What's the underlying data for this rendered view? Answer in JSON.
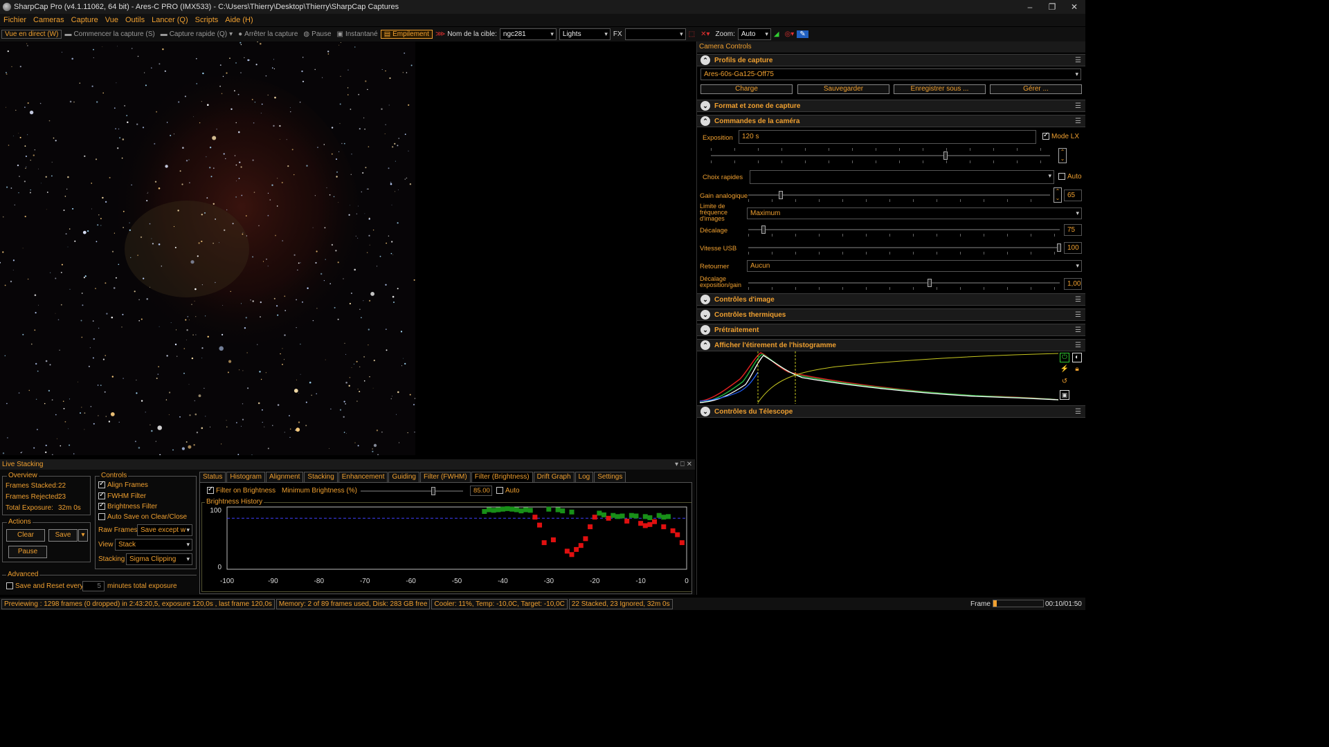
{
  "titlebar": {
    "title": "SharpCap Pro (v4.1.11062, 64 bit) - Ares-C PRO (IMX533) - C:\\Users\\Thierry\\Desktop\\Thierry\\SharpCap Captures"
  },
  "menu": [
    "Fichier",
    "Cameras",
    "Capture",
    "Vue",
    "Outils",
    "Lancer (Q)",
    "Scripts",
    "Aide (H)"
  ],
  "toolbar": {
    "live": "Vue en direct (W)",
    "start_capture": "Commencer la capture (S)",
    "quick_capture": "Capture rapide (Q)",
    "stop_capture": "Arrêter la capture",
    "pause": "Pause",
    "snapshot": "Instantané",
    "stacking": "Empilement",
    "target_label": "Nom de la cible:",
    "target_value": "ngc281",
    "frame_type": "Lights",
    "fx_label": "FX",
    "fx_value": "",
    "zoom_label": "Zoom:",
    "zoom_value": "Auto"
  },
  "camera_controls": {
    "header": "Camera Controls",
    "profiles": {
      "title": "Profils de capture",
      "selected": "Ares-60s-Ga125-Off75",
      "buttons": [
        "Charge",
        "Sauvegarder",
        "Enregistrer sous ...",
        "Gérer ..."
      ]
    },
    "format_title": "Format et zone de capture",
    "commands_title": "Commandes de la caméra",
    "exposure_label": "Exposition",
    "exposure_value": "120 s",
    "lx_mode": "Mode LX",
    "quick_choices": "Choix rapides",
    "auto": "Auto",
    "gain_label": "Gain analogique",
    "gain_value": "65",
    "frame_limit_label": "Limite de fréquence d'images",
    "frame_limit_value": "Maximum",
    "offset_label": "Décalage",
    "offset_value": "75",
    "usb_label": "Vitesse USB",
    "usb_value": "100",
    "flip_label": "Retourner",
    "flip_value": "Aucun",
    "exp_gain_label": "Décalage exposition/gain",
    "exp_gain_value": "1,00",
    "image_controls": "Contrôles d'image",
    "thermal": "Contrôles thermiques",
    "preprocessing": "Prétraitement",
    "histogram": "Afficher l'étirement de l'histogramme",
    "telescope": "Contrôles du Télescope"
  },
  "live_stacking": {
    "header": "Live Stacking",
    "overview_title": "Overview",
    "frames_stacked_label": "Frames Stacked:",
    "frames_stacked": "22",
    "frames_rejected_label": "Frames Rejected:",
    "frames_rejected": "23",
    "total_exposure_label": "Total Exposure:",
    "total_exposure": "32m 0s",
    "actions_title": "Actions",
    "clear": "Clear",
    "save": "Save",
    "pause": "Pause",
    "advanced_title": "Advanced",
    "save_reset": "Save and Reset every",
    "save_reset_value": "5",
    "minutes_total": "minutes total exposure",
    "controls_title": "Controls",
    "align_frames": "Align Frames",
    "fwhm_filter": "FWHM Filter",
    "brightness_filter": "Brightness Filter",
    "auto_save": "Auto Save on Clear/Close",
    "raw_frames_label": "Raw Frames",
    "raw_frames_value": "Save except w",
    "view_label": "View",
    "view_value": "Stack",
    "stacking_label": "Stacking",
    "stacking_value": "Sigma Clipping",
    "tabs": [
      "Status",
      "Histogram",
      "Alignment",
      "Stacking",
      "Enhancement",
      "Guiding",
      "Filter (FWHM)",
      "Filter (Brightness)",
      "Drift Graph",
      "Log",
      "Settings"
    ],
    "filter_on_brightness": "Filter on Brightness",
    "min_brightness_label": "Minimum Brightness (%)",
    "min_brightness_value": "85.00",
    "auto": "Auto",
    "history_title": "Brightness History"
  },
  "chart_data": {
    "type": "scatter",
    "title": "Brightness History",
    "xlim": [
      -100,
      0
    ],
    "ylim": [
      0,
      100
    ],
    "x_ticks": [
      -100,
      -90,
      -80,
      -70,
      -60,
      -50,
      -40,
      -30,
      -20,
      -10,
      0
    ],
    "y_ticks": [
      0,
      100
    ],
    "threshold": 85,
    "accepted": [
      [
        -44,
        97
      ],
      [
        -43,
        100
      ],
      [
        -42,
        99
      ],
      [
        -41,
        100
      ],
      [
        -40,
        101
      ],
      [
        -39,
        102
      ],
      [
        -38,
        101
      ],
      [
        -37,
        100
      ],
      [
        -36,
        98
      ],
      [
        -35,
        100
      ],
      [
        -34,
        99
      ],
      [
        -30,
        101
      ],
      [
        -28,
        100
      ],
      [
        -27,
        98
      ],
      [
        -25,
        96
      ],
      [
        -19,
        94
      ],
      [
        -18,
        91
      ],
      [
        -16,
        90
      ],
      [
        -15,
        88
      ],
      [
        -14,
        89
      ],
      [
        -12,
        90
      ],
      [
        -11,
        89
      ],
      [
        -9,
        88
      ],
      [
        -8,
        86
      ],
      [
        -6,
        90
      ],
      [
        -5,
        87
      ],
      [
        -4,
        88
      ]
    ],
    "rejected": [
      [
        -33,
        87
      ],
      [
        -32,
        73
      ],
      [
        -31,
        42
      ],
      [
        -29,
        47
      ],
      [
        -26,
        27
      ],
      [
        -25,
        21
      ],
      [
        -24,
        30
      ],
      [
        -23,
        37
      ],
      [
        -22,
        49
      ],
      [
        -21,
        70
      ],
      [
        -20,
        87
      ],
      [
        -17,
        85
      ],
      [
        -13,
        80
      ],
      [
        -10,
        76
      ],
      [
        -9,
        72
      ],
      [
        -8,
        74
      ],
      [
        -7,
        79
      ],
      [
        -5,
        70
      ],
      [
        -3,
        63
      ],
      [
        -2,
        56
      ],
      [
        -1,
        42
      ]
    ]
  }
}
